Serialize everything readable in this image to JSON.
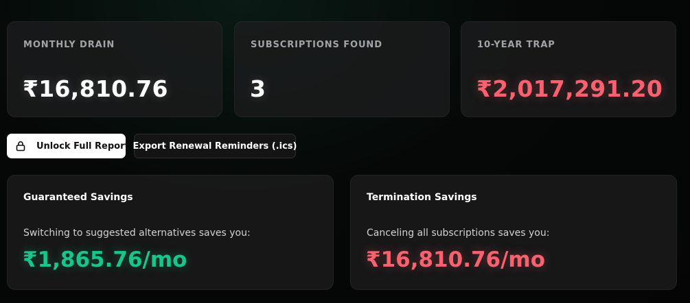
{
  "stats": [
    {
      "label": "MONTHLY DRAIN",
      "value": "₹16,810.76"
    },
    {
      "label": "SUBSCRIPTIONS FOUND",
      "value": "3"
    },
    {
      "label": "10-YEAR TRAP",
      "value": "₹2,017,291.20"
    }
  ],
  "actions": {
    "unlock_label": "Unlock Full Report",
    "unlock_icon": "lock-icon",
    "export_label": "Export Renewal Reminders (.ics)"
  },
  "savings": [
    {
      "title": "Guaranteed Savings",
      "description": "Switching to suggested alternatives saves you:",
      "amount": "₹1,865.76/mo"
    },
    {
      "title": "Termination Savings",
      "description": "Canceling all subscriptions saves you:",
      "amount": "₹16,810.76/mo"
    }
  ],
  "colors": {
    "negative": "#f8626f",
    "positive": "#19c58a",
    "card_bg": "#1c1c1e"
  }
}
